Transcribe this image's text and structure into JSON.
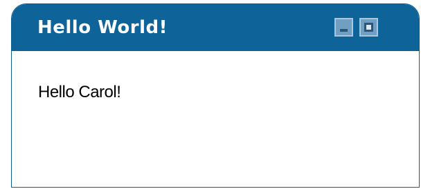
{
  "window": {
    "title": "Hello World!",
    "minimize_icon": "minimize-icon",
    "maximize_icon": "maximize-icon"
  },
  "content": {
    "message": "Hello Carol!"
  },
  "colors": {
    "titlebar": "#0e6499",
    "border": "#0d5e8f",
    "control_fill": "#6f9fc2",
    "control_border": "#a9c8de",
    "title_text": "#ffffff",
    "body_text": "#000000",
    "background": "#ffffff"
  }
}
